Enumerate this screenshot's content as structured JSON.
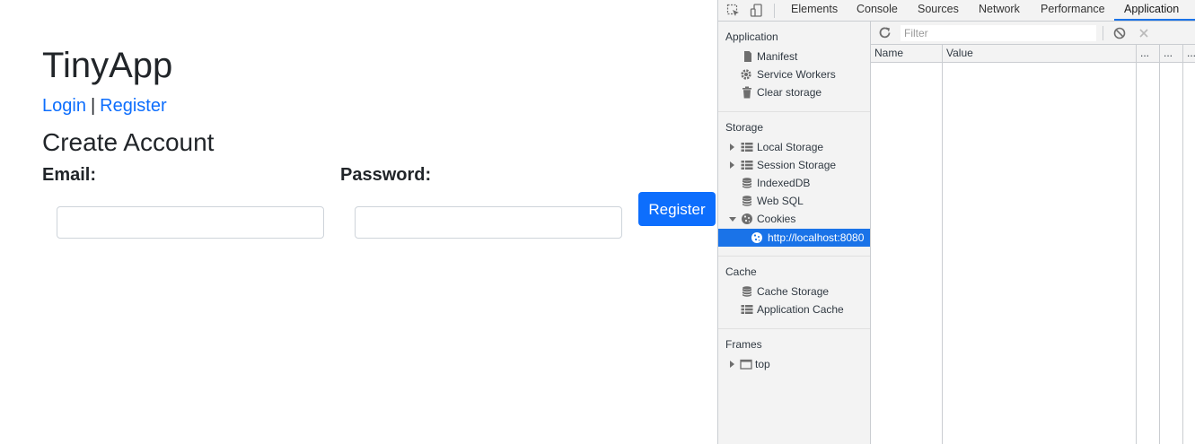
{
  "page": {
    "title": "TinyApp",
    "nav": {
      "login": "Login",
      "separator": "|",
      "register": "Register"
    },
    "heading": "Create Account",
    "form": {
      "email_label": "Email:",
      "email_value": "",
      "password_label": "Password:",
      "password_value": "",
      "submit_label": "Register"
    }
  },
  "devtools": {
    "tabs": [
      "Elements",
      "Console",
      "Sources",
      "Network",
      "Performance",
      "Application"
    ],
    "active_tab": "Application",
    "sidebar": {
      "application": {
        "header": "Application",
        "items": [
          "Manifest",
          "Service Workers",
          "Clear storage"
        ]
      },
      "storage": {
        "header": "Storage",
        "items": [
          "Local Storage",
          "Session Storage",
          "IndexedDB",
          "Web SQL",
          "Cookies"
        ],
        "cookie_origin": "http://localhost:8080"
      },
      "cache": {
        "header": "Cache",
        "items": [
          "Cache Storage",
          "Application Cache"
        ]
      },
      "frames": {
        "header": "Frames",
        "items": [
          "top"
        ]
      }
    },
    "filter": {
      "placeholder": "Filter",
      "value": ""
    },
    "columns": [
      "Name",
      "Value",
      "...",
      "...",
      "..."
    ],
    "colors": {
      "accent": "#1a73e8",
      "button": "#0d6efd",
      "link": "#0d6efd"
    }
  }
}
